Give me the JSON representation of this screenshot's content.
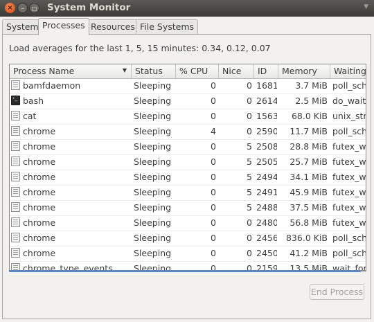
{
  "window": {
    "title": "System Monitor",
    "close_glyph": "×",
    "min_glyph": "–",
    "max_glyph": "□",
    "menu_glyph": "▼"
  },
  "tabs": [
    {
      "label": "System",
      "active": false
    },
    {
      "label": "Processes",
      "active": true
    },
    {
      "label": "Resources",
      "active": false
    },
    {
      "label": "File Systems",
      "active": false
    }
  ],
  "load_averages": "Load averages for the last 1, 5, 15 minutes: 0.34, 0.12, 0.07",
  "table": {
    "columns": [
      "Process Name",
      "Status",
      "% CPU",
      "Nice",
      "ID",
      "Memory",
      "Waiting Channel"
    ],
    "sort_glyph": "▼",
    "rows": [
      {
        "icon": "process-icon",
        "name": "bamfdaemon",
        "status": "Sleeping",
        "cpu": "0",
        "nice": "0",
        "id": "1681",
        "memory": "3.7 MiB",
        "waiting": "poll_schedule_timeout"
      },
      {
        "icon": "terminal-icon",
        "name": "bash",
        "status": "Sleeping",
        "cpu": "0",
        "nice": "0",
        "id": "2614",
        "memory": "2.5 MiB",
        "waiting": "do_wait"
      },
      {
        "icon": "process-icon",
        "name": "cat",
        "status": "Sleeping",
        "cpu": "0",
        "nice": "0",
        "id": "1563",
        "memory": "68.0 KiB",
        "waiting": "unix_stream_recvmsg"
      },
      {
        "icon": "process-icon",
        "name": "chrome",
        "status": "Sleeping",
        "cpu": "4",
        "nice": "0",
        "id": "2590",
        "memory": "11.7 MiB",
        "waiting": "poll_schedule_timeout"
      },
      {
        "icon": "process-icon",
        "name": "chrome",
        "status": "Sleeping",
        "cpu": "0",
        "nice": "5",
        "id": "2508",
        "memory": "28.8 MiB",
        "waiting": "futex_wait_queue_me"
      },
      {
        "icon": "process-icon",
        "name": "chrome",
        "status": "Sleeping",
        "cpu": "0",
        "nice": "5",
        "id": "2505",
        "memory": "25.7 MiB",
        "waiting": "futex_wait_queue_me"
      },
      {
        "icon": "process-icon",
        "name": "chrome",
        "status": "Sleeping",
        "cpu": "0",
        "nice": "5",
        "id": "2494",
        "memory": "34.1 MiB",
        "waiting": "futex_wait_queue_me"
      },
      {
        "icon": "process-icon",
        "name": "chrome",
        "status": "Sleeping",
        "cpu": "0",
        "nice": "5",
        "id": "2491",
        "memory": "45.9 MiB",
        "waiting": "futex_wait_queue_me"
      },
      {
        "icon": "process-icon",
        "name": "chrome",
        "status": "Sleeping",
        "cpu": "0",
        "nice": "5",
        "id": "2488",
        "memory": "37.5 MiB",
        "waiting": "futex_wait_queue_me"
      },
      {
        "icon": "process-icon",
        "name": "chrome",
        "status": "Sleeping",
        "cpu": "0",
        "nice": "0",
        "id": "2480",
        "memory": "56.8 MiB",
        "waiting": "futex_wait_queue_me"
      },
      {
        "icon": "process-icon",
        "name": "chrome",
        "status": "Sleeping",
        "cpu": "0",
        "nice": "0",
        "id": "2456",
        "memory": "836.0 KiB",
        "waiting": "poll_schedule_timeout"
      },
      {
        "icon": "process-icon",
        "name": "chrome",
        "status": "Sleeping",
        "cpu": "0",
        "nice": "0",
        "id": "2450",
        "memory": "41.2 MiB",
        "waiting": "poll_schedule_timeout"
      },
      {
        "icon": "process-icon",
        "name": "chrome_type_events",
        "status": "Sleeping",
        "cpu": "0",
        "nice": "0",
        "id": "2159",
        "memory": "13.5 MiB",
        "waiting": "wait_for_completion"
      }
    ]
  },
  "end_process_label": "End Process"
}
